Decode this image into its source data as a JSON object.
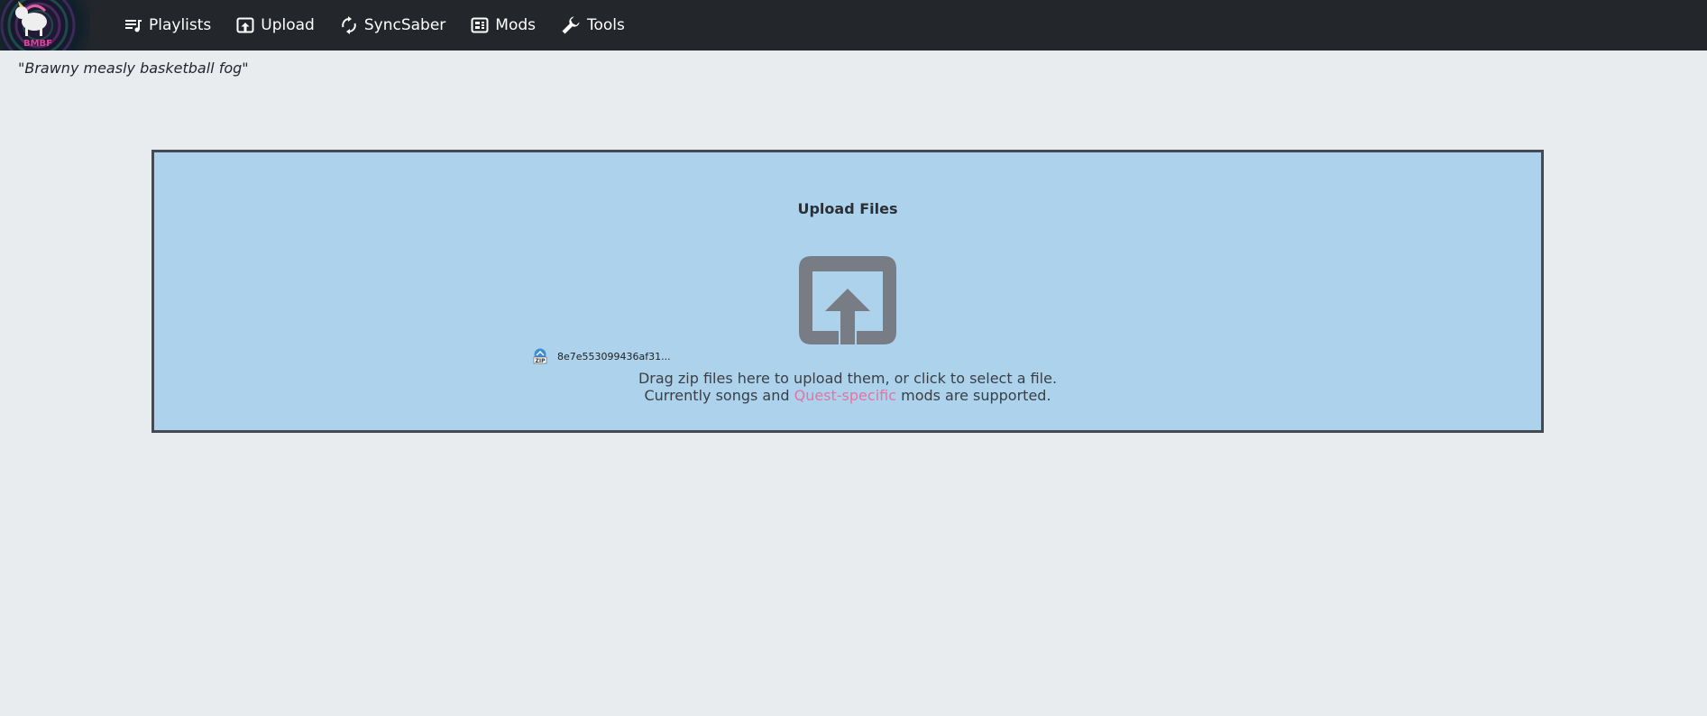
{
  "app": {
    "logo_text": "BMBF"
  },
  "nav": {
    "items": [
      {
        "label": "Playlists",
        "icon": "playlist-icon"
      },
      {
        "label": "Upload",
        "icon": "upload-icon"
      },
      {
        "label": "SyncSaber",
        "icon": "sync-icon"
      },
      {
        "label": "Mods",
        "icon": "mods-icon"
      },
      {
        "label": "Tools",
        "icon": "wrench-icon"
      }
    ]
  },
  "quote": "\"Brawny measly basketball fog\"",
  "upload": {
    "title": "Upload Files",
    "icon": "upload-large-icon",
    "file": {
      "icon": "zip-file-icon",
      "icon_label": "ZIP",
      "name": "8e7e553099436af31..."
    },
    "line1": "Drag zip files here to upload them, or click to select a file.",
    "line2_before": "Currently songs and ",
    "line2_link": "Quest-specific",
    "line2_after": " mods are supported."
  },
  "colors": {
    "navbar": "#23272b",
    "background": "#e8ecef",
    "dropzone": "#acd2ec",
    "dropzone_border": "#454a52",
    "icon_gray": "#787c85",
    "link_pink": "#e573a3"
  }
}
